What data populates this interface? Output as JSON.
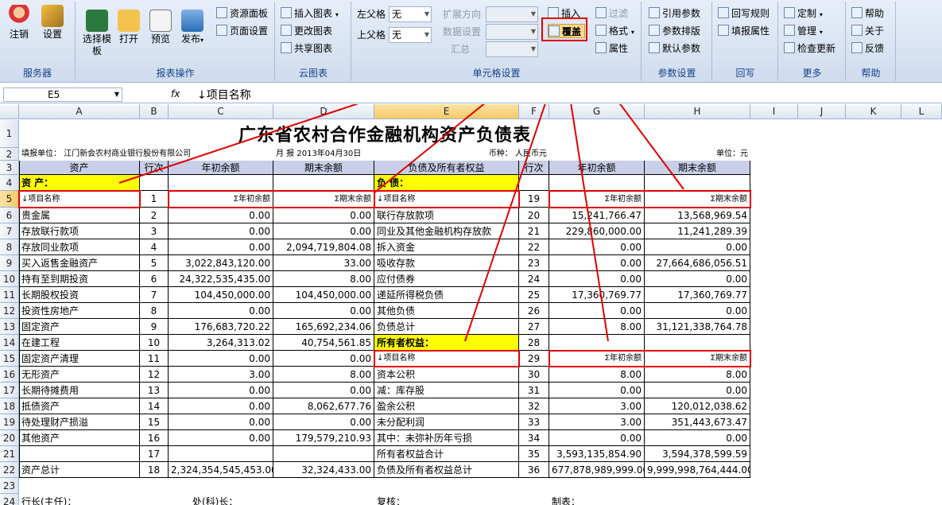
{
  "ribbon": {
    "groups": [
      {
        "label": "服务器",
        "buttons": [
          "注销",
          "设置"
        ]
      },
      {
        "label": "报表操作",
        "buttons": [
          "选择模板",
          "打开",
          "预览",
          "发布"
        ]
      },
      {
        "label": "云图表",
        "buttons": [
          "插入图表",
          "更改图表",
          "共享图表"
        ]
      },
      {
        "label": "单元格设置"
      },
      {
        "label": "参数设置",
        "buttons": [
          "引用参数",
          "参数排版",
          "默认参数"
        ]
      },
      {
        "label": "回写",
        "buttons": [
          "回写规则",
          "填报属性"
        ]
      },
      {
        "label": "更多",
        "buttons": [
          "定制",
          "管理",
          "检查更新"
        ]
      },
      {
        "label": "帮助",
        "buttons": [
          "帮助",
          "关于",
          "反馈"
        ]
      }
    ],
    "panel_buttons": [
      "资源面板",
      "页面设置"
    ],
    "cell_settings": {
      "left_parent_label": "左父格",
      "left_parent_value": "无",
      "top_parent_label": "上父格",
      "top_parent_value": "无",
      "expand_label": "扩展方向",
      "data_label": "数据设置",
      "summary_label": "汇总",
      "insert": "插入",
      "cover": "覆盖",
      "filter": "过滤",
      "format": "格式",
      "property": "属性"
    }
  },
  "formula_bar": {
    "cell_ref": "E5",
    "fx": "fx",
    "content": "↓项目名称"
  },
  "columns": [
    "A",
    "B",
    "C",
    "D",
    "E",
    "F",
    "G",
    "H",
    "I",
    "J",
    "K",
    "L"
  ],
  "rows": [
    "1",
    "2",
    "3",
    "4",
    "5",
    "6",
    "7",
    "8",
    "9",
    "10",
    "11",
    "12",
    "13",
    "14",
    "15",
    "16",
    "17",
    "18",
    "19",
    "20",
    "21",
    "22",
    "23",
    "24"
  ],
  "sheet": {
    "title": "广东省农村合作金融机构资产负债表",
    "filler": "填报单位：  江门新会农村商业银行股份有限公司",
    "period": "月 报  2013年04月30日",
    "currency": "币种：  人民币元",
    "unit": "单位：元",
    "headers": [
      "资产",
      "行次",
      "年初余额",
      "期末余额",
      "负债及所有者权益",
      "行次",
      "年初余额",
      "期末余额"
    ],
    "section_assets": "资  产：",
    "section_liab": "负  债：",
    "section_equity": "所有者权益：",
    "placeholder_name": "↓项目名称",
    "placeholder_begin": "Σ年初余额",
    "placeholder_end": "Σ期末余额",
    "row5": {
      "left_no": "1",
      "right_no": "19"
    },
    "row14_right_no": "28",
    "row15": {
      "left_name": "固定资产清理",
      "left_no": "11",
      "left_begin": "0.00",
      "left_end": "0.00",
      "right_no": "29"
    },
    "body_left": [
      {
        "name": "贵金属",
        "no": "2",
        "begin": "0.00",
        "end": "0.00"
      },
      {
        "name": "存放联行款项",
        "no": "3",
        "begin": "0.00",
        "end": "0.00"
      },
      {
        "name": "存放同业款项",
        "no": "4",
        "begin": "0.00",
        "end": "2,094,719,804.08"
      },
      {
        "name": "买入返售金融资产",
        "no": "5",
        "begin": "3,022,843,120.00",
        "end": "33.00"
      },
      {
        "name": "持有至到期投资",
        "no": "6",
        "begin": "24,322,535,435.00",
        "end": "8.00"
      },
      {
        "name": "长期股权投资",
        "no": "7",
        "begin": "104,450,000.00",
        "end": "104,450,000.00"
      },
      {
        "name": "投资性房地产",
        "no": "8",
        "begin": "0.00",
        "end": "0.00"
      },
      {
        "name": "固定资产",
        "no": "9",
        "begin": "176,683,720.22",
        "end": "165,692,234.06"
      },
      {
        "name": "在建工程",
        "no": "10",
        "begin": "3,264,313.02",
        "end": "40,754,561.85"
      }
    ],
    "body_right": [
      {
        "name": "联行存放款项",
        "no": "20",
        "begin": "15,241,766.47",
        "end": "13,568,969.54"
      },
      {
        "name": "同业及其他金融机构存放款",
        "no": "21",
        "begin": "229,860,000.00",
        "end": "11,241,289.39"
      },
      {
        "name": "拆入资金",
        "no": "22",
        "begin": "0.00",
        "end": "0.00"
      },
      {
        "name": "吸收存款",
        "no": "23",
        "begin": "0.00",
        "end": "27,664,686,056.51"
      },
      {
        "name": "应付债券",
        "no": "24",
        "begin": "0.00",
        "end": "0.00"
      },
      {
        "name": "递延所得税负债",
        "no": "25",
        "begin": "17,360,769.77",
        "end": "17,360,769.77"
      },
      {
        "name": "其他负债",
        "no": "26",
        "begin": "0.00",
        "end": "0.00"
      },
      {
        "name": "负债总计",
        "no": "27",
        "begin": "8.00",
        "end": "31,121,338,764.78"
      }
    ],
    "lower_left": [
      {
        "name": "无形资产",
        "no": "12",
        "begin": "3.00",
        "end": "8.00"
      },
      {
        "name": "长期待摊费用",
        "no": "13",
        "begin": "0.00",
        "end": "0.00"
      },
      {
        "name": "抵债资产",
        "no": "14",
        "begin": "0.00",
        "end": "8,062,677.76"
      },
      {
        "name": "待处理财产损溢",
        "no": "15",
        "begin": "0.00",
        "end": "0.00"
      },
      {
        "name": "其他资产",
        "no": "16",
        "begin": "0.00",
        "end": "179,579,210.93"
      },
      {
        "name": "",
        "no": "17",
        "begin": "",
        "end": ""
      },
      {
        "name": "资产总计",
        "no": "18",
        "begin": "2,324,354,545,453.00",
        "end": "32,324,433.00"
      }
    ],
    "lower_right": [
      {
        "name": "资本公积",
        "no": "30",
        "begin": "8.00",
        "end": "8.00"
      },
      {
        "name": "减：库存股",
        "no": "31",
        "begin": "0.00",
        "end": "0.00"
      },
      {
        "name": "盈余公积",
        "no": "32",
        "begin": "3.00",
        "end": "120,012,038.62"
      },
      {
        "name": "未分配利润",
        "no": "33",
        "begin": "3.00",
        "end": "351,443,673.47"
      },
      {
        "name": "其中：未弥补历年亏损",
        "no": "34",
        "begin": "0.00",
        "end": "0.00"
      },
      {
        "name": "所有者权益合计",
        "no": "35",
        "begin": "3,593,135,854.90",
        "end": "3,594,378,599.59"
      },
      {
        "name": "负债及所有者权益总计",
        "no": "36",
        "begin": "677,878,989,999.00",
        "end": "9,999,998,764,444.00"
      }
    ],
    "footer": {
      "president": "行长(主任)：",
      "chief": "处(科)长：",
      "review": "复核：",
      "maker": "制表："
    }
  }
}
